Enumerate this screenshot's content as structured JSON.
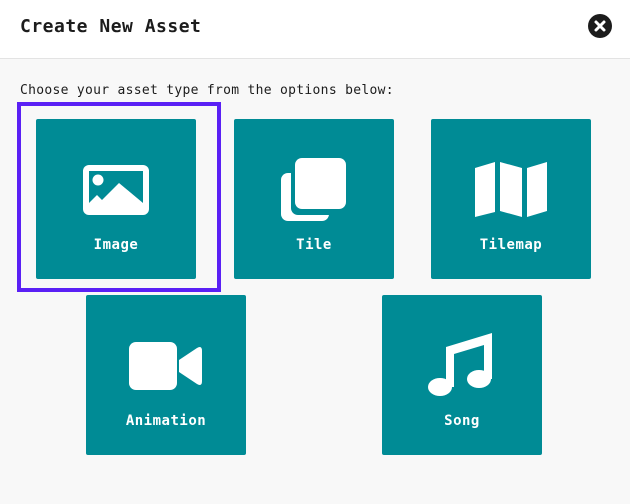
{
  "dialog": {
    "title": "Create New Asset",
    "close_icon": "close-circle-icon"
  },
  "prompt": "Choose your asset type from the options below:",
  "colors": {
    "tile_background": "#008b95",
    "selection_outline": "#5a20f5",
    "icon_color": "#ffffff"
  },
  "options": [
    {
      "label": "Image",
      "icon": "image-icon",
      "selected": true
    },
    {
      "label": "Tile",
      "icon": "tile-icon",
      "selected": false
    },
    {
      "label": "Tilemap",
      "icon": "tilemap-icon",
      "selected": false
    },
    {
      "label": "Animation",
      "icon": "video-camera-icon",
      "selected": false
    },
    {
      "label": "Song",
      "icon": "music-note-icon",
      "selected": false
    }
  ]
}
